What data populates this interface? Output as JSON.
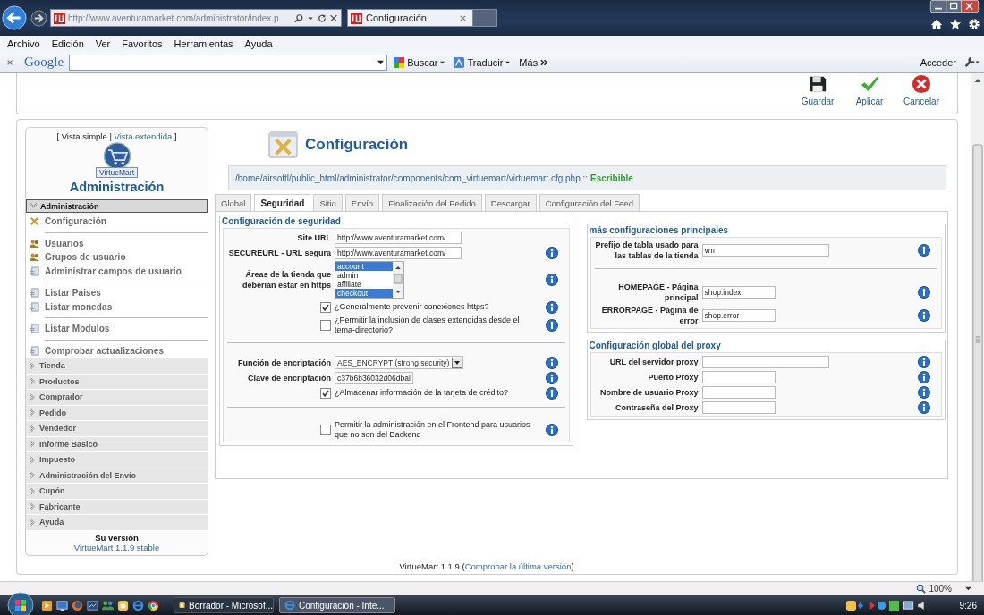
{
  "browser": {
    "address": "http://www.aventuramarket.com/administrator/index.p",
    "tabs": [
      {
        "label": "Configuración",
        "selected": true
      }
    ],
    "menu": [
      "Archivo",
      "Edición",
      "Ver",
      "Favoritos",
      "Herramientas",
      "Ayuda"
    ],
    "google_bar": {
      "logo": "Google",
      "buttons": [
        {
          "label": "Buscar",
          "kind": "search"
        },
        {
          "label": "Traducir",
          "kind": "translate"
        }
      ],
      "more": "Más",
      "sign_in": "Acceder"
    }
  },
  "toolbar": [
    {
      "label": "Guardar",
      "kind": "save"
    },
    {
      "label": "Aplicar",
      "kind": "apply"
    },
    {
      "label": "Cancelar",
      "kind": "cancel"
    }
  ],
  "sidebar": {
    "view_prefix": "[ Vista simple |",
    "view_link": "Vista extendida",
    "view_suffix": "]",
    "logo_text": "VirtueMart",
    "title": "Administración",
    "sections": [
      {
        "label": "Administración",
        "expanded": true,
        "groups": [
          {
            "items": [
              {
                "label": "Configuración",
                "kind": "tools"
              }
            ]
          },
          {
            "items": [
              {
                "label": "Usuarios",
                "kind": "users"
              },
              {
                "label": "Grupos de usuario",
                "kind": "users"
              },
              {
                "label": "Administrar campos de usuario",
                "kind": "page"
              }
            ]
          },
          {
            "items": [
              {
                "label": "Listar Paises",
                "kind": "page"
              },
              {
                "label": "Listar monedas",
                "kind": "page"
              }
            ]
          },
          {
            "items": [
              {
                "label": "Listar Modulos",
                "kind": "page"
              }
            ]
          },
          {
            "items": [
              {
                "label": "Comprobar actualizaciones",
                "kind": "page"
              }
            ]
          }
        ]
      },
      {
        "label": "Tienda",
        "expanded": false
      },
      {
        "label": "Productos",
        "expanded": false
      },
      {
        "label": "Comprador",
        "expanded": false
      },
      {
        "label": "Pedido",
        "expanded": false
      },
      {
        "label": "Vendedor",
        "expanded": false
      },
      {
        "label": "Informe Basico",
        "expanded": false
      },
      {
        "label": "Impuesto",
        "expanded": false
      },
      {
        "label": "Administración del Envío",
        "expanded": false
      },
      {
        "label": "Cupón",
        "expanded": false
      },
      {
        "label": "Fabricante",
        "expanded": false
      },
      {
        "label": "Ayuda",
        "expanded": false
      }
    ],
    "version_label": "Su versión",
    "version": "VirtueMart 1.1.9 stable"
  },
  "content": {
    "title": "Configuración",
    "path": "/home/airsoftl/public_html/administrator/components/com_virtuemart/virtuemart.cfg.php ::",
    "path_status": "Escribible",
    "tabs": [
      {
        "label": "Global",
        "selected": false
      },
      {
        "label": "Seguridad",
        "selected": true
      },
      {
        "label": "Sitio",
        "selected": false
      },
      {
        "label": "Envío",
        "selected": false
      },
      {
        "label": "Finalización del Pedido",
        "selected": false
      },
      {
        "label": "Descargar",
        "selected": false
      },
      {
        "label": "Configuración del Feed",
        "selected": false
      }
    ],
    "left": [
      {
        "legend": "Configuración de seguridad",
        "groups": [
          {
            "rows": [
              {
                "kind": "text",
                "label": "Site URL",
                "value": "http://www.aventuramarket.com/",
                "info": false
              },
              {
                "kind": "text",
                "label": "SECUREURL - URL segura",
                "value": "http://www.aventuramarket.com/",
                "info": true
              },
              {
                "kind": "listbox",
                "label": "Áreas de la tienda que deberian estar en https",
                "options": [
                  {
                    "label": "account",
                    "selected": true
                  },
                  {
                    "label": "admin",
                    "selected": false
                  },
                  {
                    "label": "affiliate",
                    "selected": false
                  },
                  {
                    "label": "checkout",
                    "selected": true
                  }
                ],
                "info": true
              },
              {
                "kind": "checkbox",
                "label": "¿Generalmente prevenir conexiones https?",
                "checked": true,
                "info": true
              },
              {
                "kind": "checkbox",
                "label": "¿Permitir la inclusión de clases extendidas desde el tema-directorio?",
                "checked": false,
                "info": true
              }
            ]
          },
          {
            "rows": [
              {
                "kind": "select",
                "label": "Función de encriptación",
                "value": "AES_ENCRYPT (strong security)",
                "info": true
              },
              {
                "kind": "short_text",
                "label": "Clave de encriptación",
                "value": "c37b6b36032d06dbal",
                "info": true
              },
              {
                "kind": "checkbox",
                "label": "¿Almacenar información de la tarjeta de crédito?",
                "checked": true,
                "info": true
              }
            ]
          },
          {
            "rows": [
              {
                "kind": "checkbox",
                "label": "Permitir la administración en el Frontend para usuarios que no son del Backend",
                "checked": false,
                "info": true
              }
            ]
          }
        ]
      }
    ],
    "right": [
      {
        "legend": "más configuraciones principales",
        "groups": [
          {
            "rows": [
              {
                "kind": "text",
                "label": "Prefijo de tabla usado para las tablas de la tienda",
                "value": "vm",
                "info": true
              }
            ]
          },
          {
            "rows": [
              {
                "kind": "short_text",
                "label": "HOMEPAGE - Página principal",
                "value": "shop.index",
                "info": true
              },
              {
                "kind": "short_text",
                "label": "ERRORPAGE - Página de error",
                "value": "shop.error",
                "info": true
              }
            ]
          }
        ]
      },
      {
        "legend": "Configuración global del proxy",
        "groups": [
          {
            "rows": [
              {
                "kind": "text",
                "label": "URL del servidor proxy",
                "info": true
              },
              {
                "kind": "short_text",
                "label": "Puerto Proxy",
                "info": true
              },
              {
                "kind": "short_text",
                "label": "Nombre de usuario Proxy",
                "info": true
              },
              {
                "kind": "short_text",
                "label": "Contraseña del Proxy",
                "info": true
              }
            ]
          }
        ]
      }
    ]
  },
  "footer": {
    "prefix": "VirtueMart 1.1.9 (",
    "link": "Comprobar la última versión",
    "suffix": ")"
  },
  "status_bar": {
    "zoom": "100%"
  },
  "taskbar": {
    "tasks": [
      {
        "label": "Borrador - Microsof...",
        "kind": "mail",
        "selected": false
      },
      {
        "label": "Configuración - Inte...",
        "kind": "browser",
        "selected": true
      }
    ],
    "clock": "9:26"
  }
}
